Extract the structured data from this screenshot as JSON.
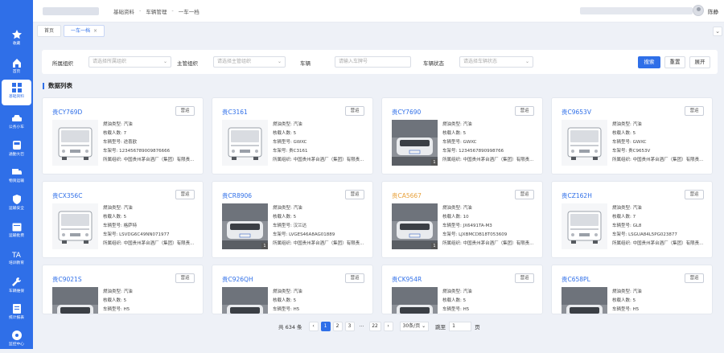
{
  "sidebar": {
    "items": [
      {
        "label": "收藏",
        "icon": "star-icon"
      },
      {
        "label": "首页",
        "icon": "home-icon"
      },
      {
        "label": "基础资料",
        "icon": "grid-icon",
        "active": true
      },
      {
        "label": "公务小车",
        "icon": "car-icon"
      },
      {
        "label": "通勤大巴",
        "icon": "bus-icon"
      },
      {
        "label": "物资运输",
        "icon": "truck-icon"
      },
      {
        "label": "运输安全",
        "icon": "shield-icon"
      },
      {
        "label": "运输批费",
        "icon": "calendar-icon"
      },
      {
        "label": "培训教育",
        "icon": "training-icon"
      },
      {
        "label": "车辆维保",
        "icon": "wrench-icon"
      },
      {
        "label": "统计报表",
        "icon": "report-icon"
      },
      {
        "label": "监控中心",
        "icon": "monitor-icon"
      }
    ]
  },
  "header": {
    "breadcrumb": [
      "基础资料",
      "车辆管理",
      "一车一档"
    ],
    "user_name": "陈静"
  },
  "tabs": [
    {
      "label": "首页",
      "active": false
    },
    {
      "label": "一车一档",
      "active": true,
      "close": "×"
    }
  ],
  "filter": {
    "fields": [
      {
        "label": "所属组织",
        "placeholder": "请选择所属组织"
      },
      {
        "label": "主管组织",
        "placeholder": "请选择主管组织"
      },
      {
        "label": "车辆",
        "placeholder": "请输入车牌号"
      },
      {
        "label": "车辆状态",
        "placeholder": "请选择车辆状态"
      }
    ],
    "search": "搜索",
    "reset": "重置",
    "expand": "展开"
  },
  "list_title": "数据列表",
  "labels": {
    "fuel": "燃油类型:",
    "seats": "核载人数:",
    "model": "车辆型号:",
    "vin": "车架号:",
    "org": "所属组织:",
    "status_btn": "营运"
  },
  "cards": [
    {
      "plate": "贵CY769D",
      "fuel": "汽油",
      "seats": "7",
      "model": "途喜欧",
      "vin": "123456789009876666",
      "org": "中国贵州茅台酒厂（集团）有限责...",
      "img": "bus",
      "yellow": false
    },
    {
      "plate": "贵C3161",
      "fuel": "汽油",
      "seats": "5",
      "model": "GWXC",
      "vin": "贵C3161",
      "org": "中国贵州茅台酒厂（集团）有限责...",
      "img": "bus",
      "yellow": false
    },
    {
      "plate": "贵CY7690",
      "fuel": "汽油",
      "seats": "5",
      "model": "GWXC",
      "vin": "1234567890998766",
      "org": "中国贵州茅台酒厂（集团）有限责...",
      "img": "photo",
      "badge": "1",
      "yellow": false
    },
    {
      "plate": "贵C9653V",
      "fuel": "汽油",
      "seats": "5",
      "model": "GWXC",
      "vin": "贵C9653V",
      "org": "中国贵州茅台酒厂（集团）有限责...",
      "img": "bus",
      "yellow": false
    },
    {
      "plate": "贵CX356C",
      "fuel": "汽油",
      "seats": "5",
      "model": "格萨特",
      "vin": "LSVDG6C49NN071977",
      "org": "中国贵州茅台酒厂（集团）有限责...",
      "img": "bus",
      "yellow": false
    },
    {
      "plate": "贵CR8906",
      "fuel": "汽油",
      "seats": "5",
      "model": "汉兰达",
      "vin": "LVGES46A8AG01889",
      "org": "中国贵州茅台酒厂（集团）有限责...",
      "img": "photo",
      "badge": "1",
      "yellow": false
    },
    {
      "plate": "贵CA5667",
      "fuel": "汽油",
      "seats": "10",
      "model": "JX6491TA-M3",
      "vin": "LJXBMCDB18T053609",
      "org": "中国贵州茅台酒厂（集团）有限责...",
      "img": "photo",
      "badge": "1",
      "yellow": true
    },
    {
      "plate": "贵CZ162H",
      "fuel": "汽油",
      "seats": "7",
      "model": "GL8",
      "vin": "LSGUA84L5PG023877",
      "org": "中国贵州茅台酒厂（集团）有限责...",
      "img": "bus",
      "yellow": false
    },
    {
      "plate": "贵C9021S",
      "fuel": "汽油",
      "seats": "5",
      "model": "H5",
      "img": "photo",
      "yellow": false
    },
    {
      "plate": "贵C926QH",
      "fuel": "汽油",
      "seats": "5",
      "model": "H5",
      "img": "photo",
      "yellow": false
    },
    {
      "plate": "贵CK954R",
      "fuel": "汽油",
      "seats": "5",
      "model": "H5",
      "img": "photo",
      "yellow": false
    },
    {
      "plate": "贵C658PL",
      "fuel": "汽油",
      "seats": "5",
      "model": "H5",
      "img": "photo",
      "yellow": false
    }
  ],
  "pager": {
    "total": "共 634 条",
    "prev": "‹",
    "pages": [
      "1",
      "2",
      "3",
      "...",
      "22"
    ],
    "next": "›",
    "page_size": "30条/页",
    "goto_label": "跳至",
    "goto_value": "1",
    "page_unit": "页"
  }
}
